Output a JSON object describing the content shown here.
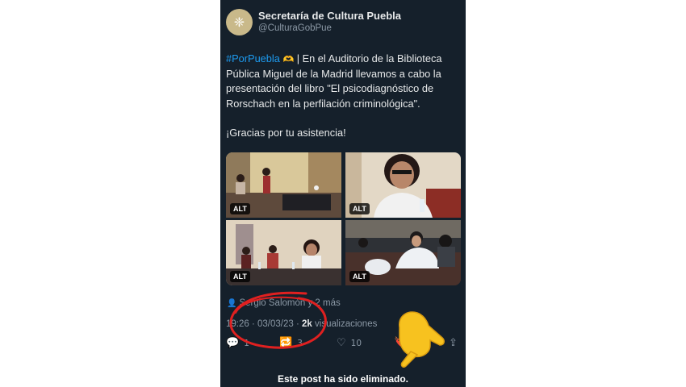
{
  "post": {
    "author_name": "Secretaría de Cultura Puebla",
    "author_handle": "@CulturaGobPue",
    "avatar_glyph": "❈",
    "hashtag": "#PorPuebla",
    "hashtag_emoji": "🫶",
    "body": " | En el Auditorio de la Biblioteca Pública Miguel de la Madrid llevamos a cabo la presentación del libro \"El psicodiagnóstico de Rorschach en la perfilación criminológica\".",
    "thanks": "¡Gracias por tu asistencia!",
    "photos": [
      {
        "alt_label": "ALT"
      },
      {
        "alt_label": "ALT"
      },
      {
        "alt_label": "ALT"
      },
      {
        "alt_label": "ALT"
      }
    ],
    "tagged_people": "Sergio Salomón y 2 más",
    "time": "19:26",
    "date": "03/03/23",
    "views_count": "2k",
    "views_label": " visualizaciones",
    "replies": "1",
    "reposts": "3",
    "likes": "10"
  },
  "notice": "Este post ha sido eliminado.",
  "icons": [
    "person-icon",
    "reply-icon",
    "repost-icon",
    "like-icon",
    "bookmark-icon",
    "share-icon"
  ],
  "colors": {
    "background": "#15202b",
    "text": "#e7e9ea",
    "secondary_text": "#8b98a5",
    "link": "#1d9bf0",
    "annotation_circle": "#e02020",
    "pointing_hand": "#f7c21f"
  }
}
